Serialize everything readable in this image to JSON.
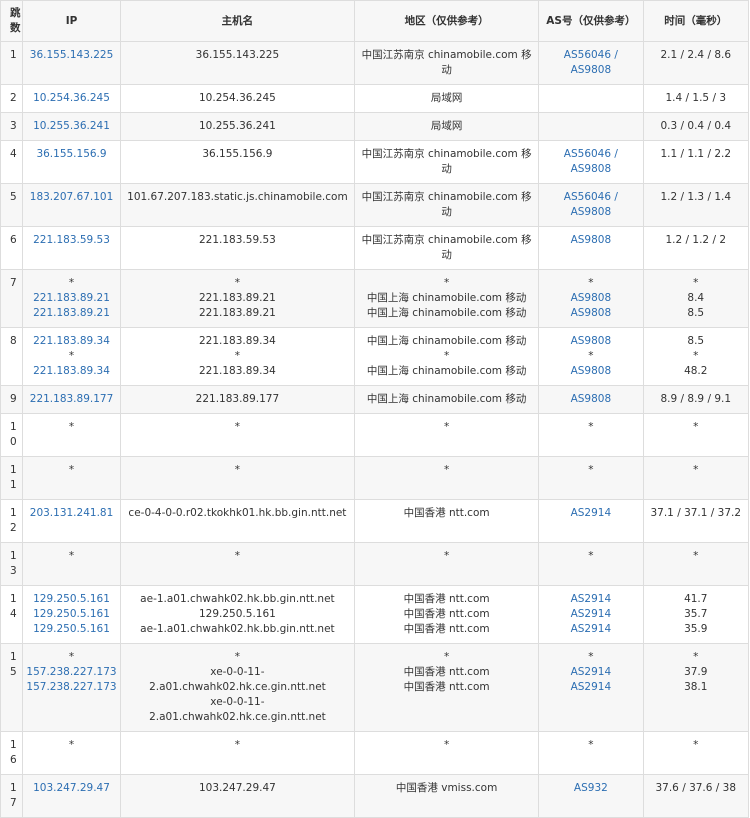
{
  "headers": {
    "hop": "跳数",
    "ip": "IP",
    "host": "主机名",
    "location": "地区（仅供参考）",
    "asn": "AS号（仅供参考）",
    "time": "时间（毫秒）"
  },
  "rows": [
    {
      "hop": "1",
      "ip": [
        "36.155.143.225"
      ],
      "host": [
        "36.155.143.225"
      ],
      "location": [
        "中国江苏南京 chinamobile.com 移动"
      ],
      "asn": [
        "AS56046 / AS9808"
      ],
      "time": [
        "2.1 / 2.4 / 8.6"
      ]
    },
    {
      "hop": "2",
      "ip": [
        "10.254.36.245"
      ],
      "host": [
        "10.254.36.245"
      ],
      "location": [
        "局域网"
      ],
      "asn": [
        ""
      ],
      "time": [
        "1.4 / 1.5 / 3"
      ]
    },
    {
      "hop": "3",
      "ip": [
        "10.255.36.241"
      ],
      "host": [
        "10.255.36.241"
      ],
      "location": [
        "局域网"
      ],
      "asn": [
        ""
      ],
      "time": [
        "0.3 / 0.4 / 0.4"
      ]
    },
    {
      "hop": "4",
      "ip": [
        "36.155.156.9"
      ],
      "host": [
        "36.155.156.9"
      ],
      "location": [
        "中国江苏南京 chinamobile.com 移动"
      ],
      "asn": [
        "AS56046 / AS9808"
      ],
      "time": [
        "1.1 / 1.1 / 2.2"
      ]
    },
    {
      "hop": "5",
      "ip": [
        "183.207.67.101"
      ],
      "host": [
        "101.67.207.183.static.js.chinamobile.com"
      ],
      "location": [
        "中国江苏南京 chinamobile.com 移动"
      ],
      "asn": [
        "AS56046 / AS9808"
      ],
      "time": [
        "1.2 / 1.3 / 1.4"
      ]
    },
    {
      "hop": "6",
      "ip": [
        "221.183.59.53"
      ],
      "host": [
        "221.183.59.53"
      ],
      "location": [
        "中国江苏南京 chinamobile.com 移动"
      ],
      "asn": [
        "AS9808"
      ],
      "time": [
        "1.2 / 1.2 / 2"
      ]
    },
    {
      "hop": "7",
      "ip": [
        "*",
        "221.183.89.21",
        "221.183.89.21"
      ],
      "host": [
        "*",
        "221.183.89.21",
        "221.183.89.21"
      ],
      "location": [
        "*",
        "中国上海 chinamobile.com 移动",
        "中国上海 chinamobile.com 移动"
      ],
      "asn": [
        "*",
        "AS9808",
        "AS9808"
      ],
      "time": [
        "*",
        "8.4",
        "8.5"
      ]
    },
    {
      "hop": "8",
      "ip": [
        "221.183.89.34",
        "*",
        "221.183.89.34"
      ],
      "host": [
        "221.183.89.34",
        "*",
        "221.183.89.34"
      ],
      "location": [
        "中国上海 chinamobile.com 移动",
        "*",
        "中国上海 chinamobile.com 移动"
      ],
      "asn": [
        "AS9808",
        "*",
        "AS9808"
      ],
      "time": [
        "8.5",
        "*",
        "48.2"
      ]
    },
    {
      "hop": "9",
      "ip": [
        "221.183.89.177"
      ],
      "host": [
        "221.183.89.177"
      ],
      "location": [
        "中国上海 chinamobile.com 移动"
      ],
      "asn": [
        "AS9808"
      ],
      "time": [
        "8.9 / 8.9 / 9.1"
      ]
    },
    {
      "hop": "10",
      "ip": [
        "*"
      ],
      "host": [
        "*"
      ],
      "location": [
        "*"
      ],
      "asn": [
        "*"
      ],
      "time": [
        "*"
      ]
    },
    {
      "hop": "11",
      "ip": [
        "*"
      ],
      "host": [
        "*"
      ],
      "location": [
        "*"
      ],
      "asn": [
        "*"
      ],
      "time": [
        "*"
      ]
    },
    {
      "hop": "12",
      "ip": [
        "203.131.241.81"
      ],
      "host": [
        "ce-0-4-0-0.r02.tkokhk01.hk.bb.gin.ntt.net"
      ],
      "location": [
        "中国香港 ntt.com"
      ],
      "asn": [
        "AS2914"
      ],
      "time": [
        "37.1 / 37.1 / 37.2"
      ]
    },
    {
      "hop": "13",
      "ip": [
        "*"
      ],
      "host": [
        "*"
      ],
      "location": [
        "*"
      ],
      "asn": [
        "*"
      ],
      "time": [
        "*"
      ]
    },
    {
      "hop": "14",
      "ip": [
        "129.250.5.161",
        "129.250.5.161",
        "129.250.5.161"
      ],
      "host": [
        "ae-1.a01.chwahk02.hk.bb.gin.ntt.net",
        "129.250.5.161",
        "ae-1.a01.chwahk02.hk.bb.gin.ntt.net"
      ],
      "location": [
        "中国香港 ntt.com",
        "中国香港 ntt.com",
        "中国香港 ntt.com"
      ],
      "asn": [
        "AS2914",
        "AS2914",
        "AS2914"
      ],
      "time": [
        "41.7",
        "35.7",
        "35.9"
      ]
    },
    {
      "hop": "15",
      "ip": [
        "*",
        "157.238.227.173",
        "157.238.227.173"
      ],
      "host": [
        "*",
        "xe-0-0-11-2.a01.chwahk02.hk.ce.gin.ntt.net",
        "xe-0-0-11-2.a01.chwahk02.hk.ce.gin.ntt.net"
      ],
      "location": [
        "*",
        "中国香港 ntt.com",
        "中国香港 ntt.com"
      ],
      "asn": [
        "*",
        "AS2914",
        "AS2914"
      ],
      "time": [
        "*",
        "37.9",
        "38.1"
      ]
    },
    {
      "hop": "16",
      "ip": [
        "*"
      ],
      "host": [
        "*"
      ],
      "location": [
        "*"
      ],
      "asn": [
        "*"
      ],
      "time": [
        "*"
      ]
    },
    {
      "hop": "17",
      "ip": [
        "103.247.29.47"
      ],
      "host": [
        "103.247.29.47"
      ],
      "location": [
        "中国香港 vmiss.com"
      ],
      "asn": [
        "AS932"
      ],
      "time": [
        "37.6 / 37.6 / 38"
      ]
    }
  ]
}
